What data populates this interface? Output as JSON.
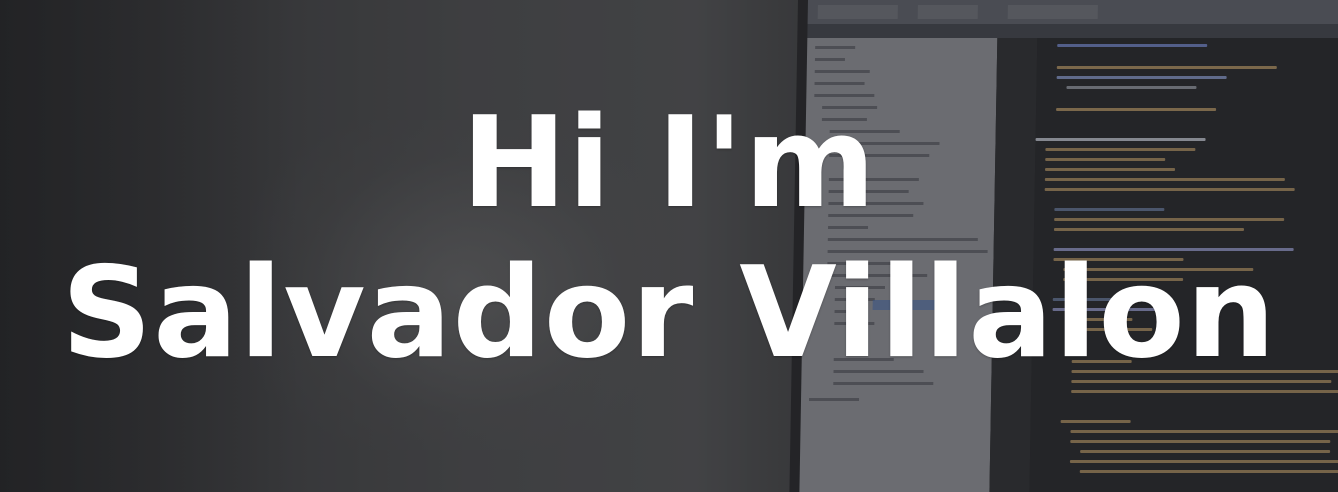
{
  "hero": {
    "line1": "Hi I'm",
    "line2": "Salvador Villalon"
  }
}
